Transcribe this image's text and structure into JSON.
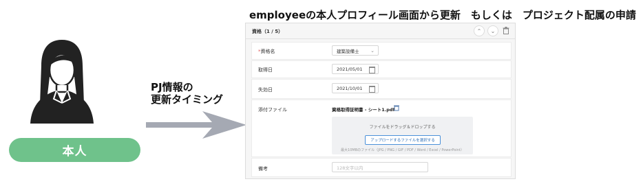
{
  "headline": "employeeの本人プロフィール画面から更新　もしくは　プロジェクト配属の申請",
  "pj_caption": {
    "line1": "PJ情報の",
    "line2": "更新タイミング"
  },
  "person_label": "本人",
  "panel": {
    "title": "資格（1 / 5）",
    "fields": {
      "qualification": {
        "label": "資格名",
        "required_mark": "*",
        "value": "建築設備士"
      },
      "acquired": {
        "label": "取得日",
        "value": "2021/05/01"
      },
      "expiry": {
        "label": "失効日",
        "value": "2021/10/01"
      },
      "attachment": {
        "label": "添付ファイル",
        "file_name": "資格取得証明書 - シート1.pdf",
        "drop_text": "ファイルをドラッグ＆ドロップする",
        "upload_button": "アップロードするファイルを選択する",
        "note": "最大10MBのファイル（JPG / PNG / GIF / PDF / Word / Excel / PowerPoint）"
      },
      "remarks": {
        "label": "備考",
        "placeholder": "128文字以内"
      }
    }
  },
  "colors": {
    "accent_green": "#6fc28b",
    "arrow_gray": "#a5a9b3",
    "link_blue": "#2d6fb8"
  }
}
